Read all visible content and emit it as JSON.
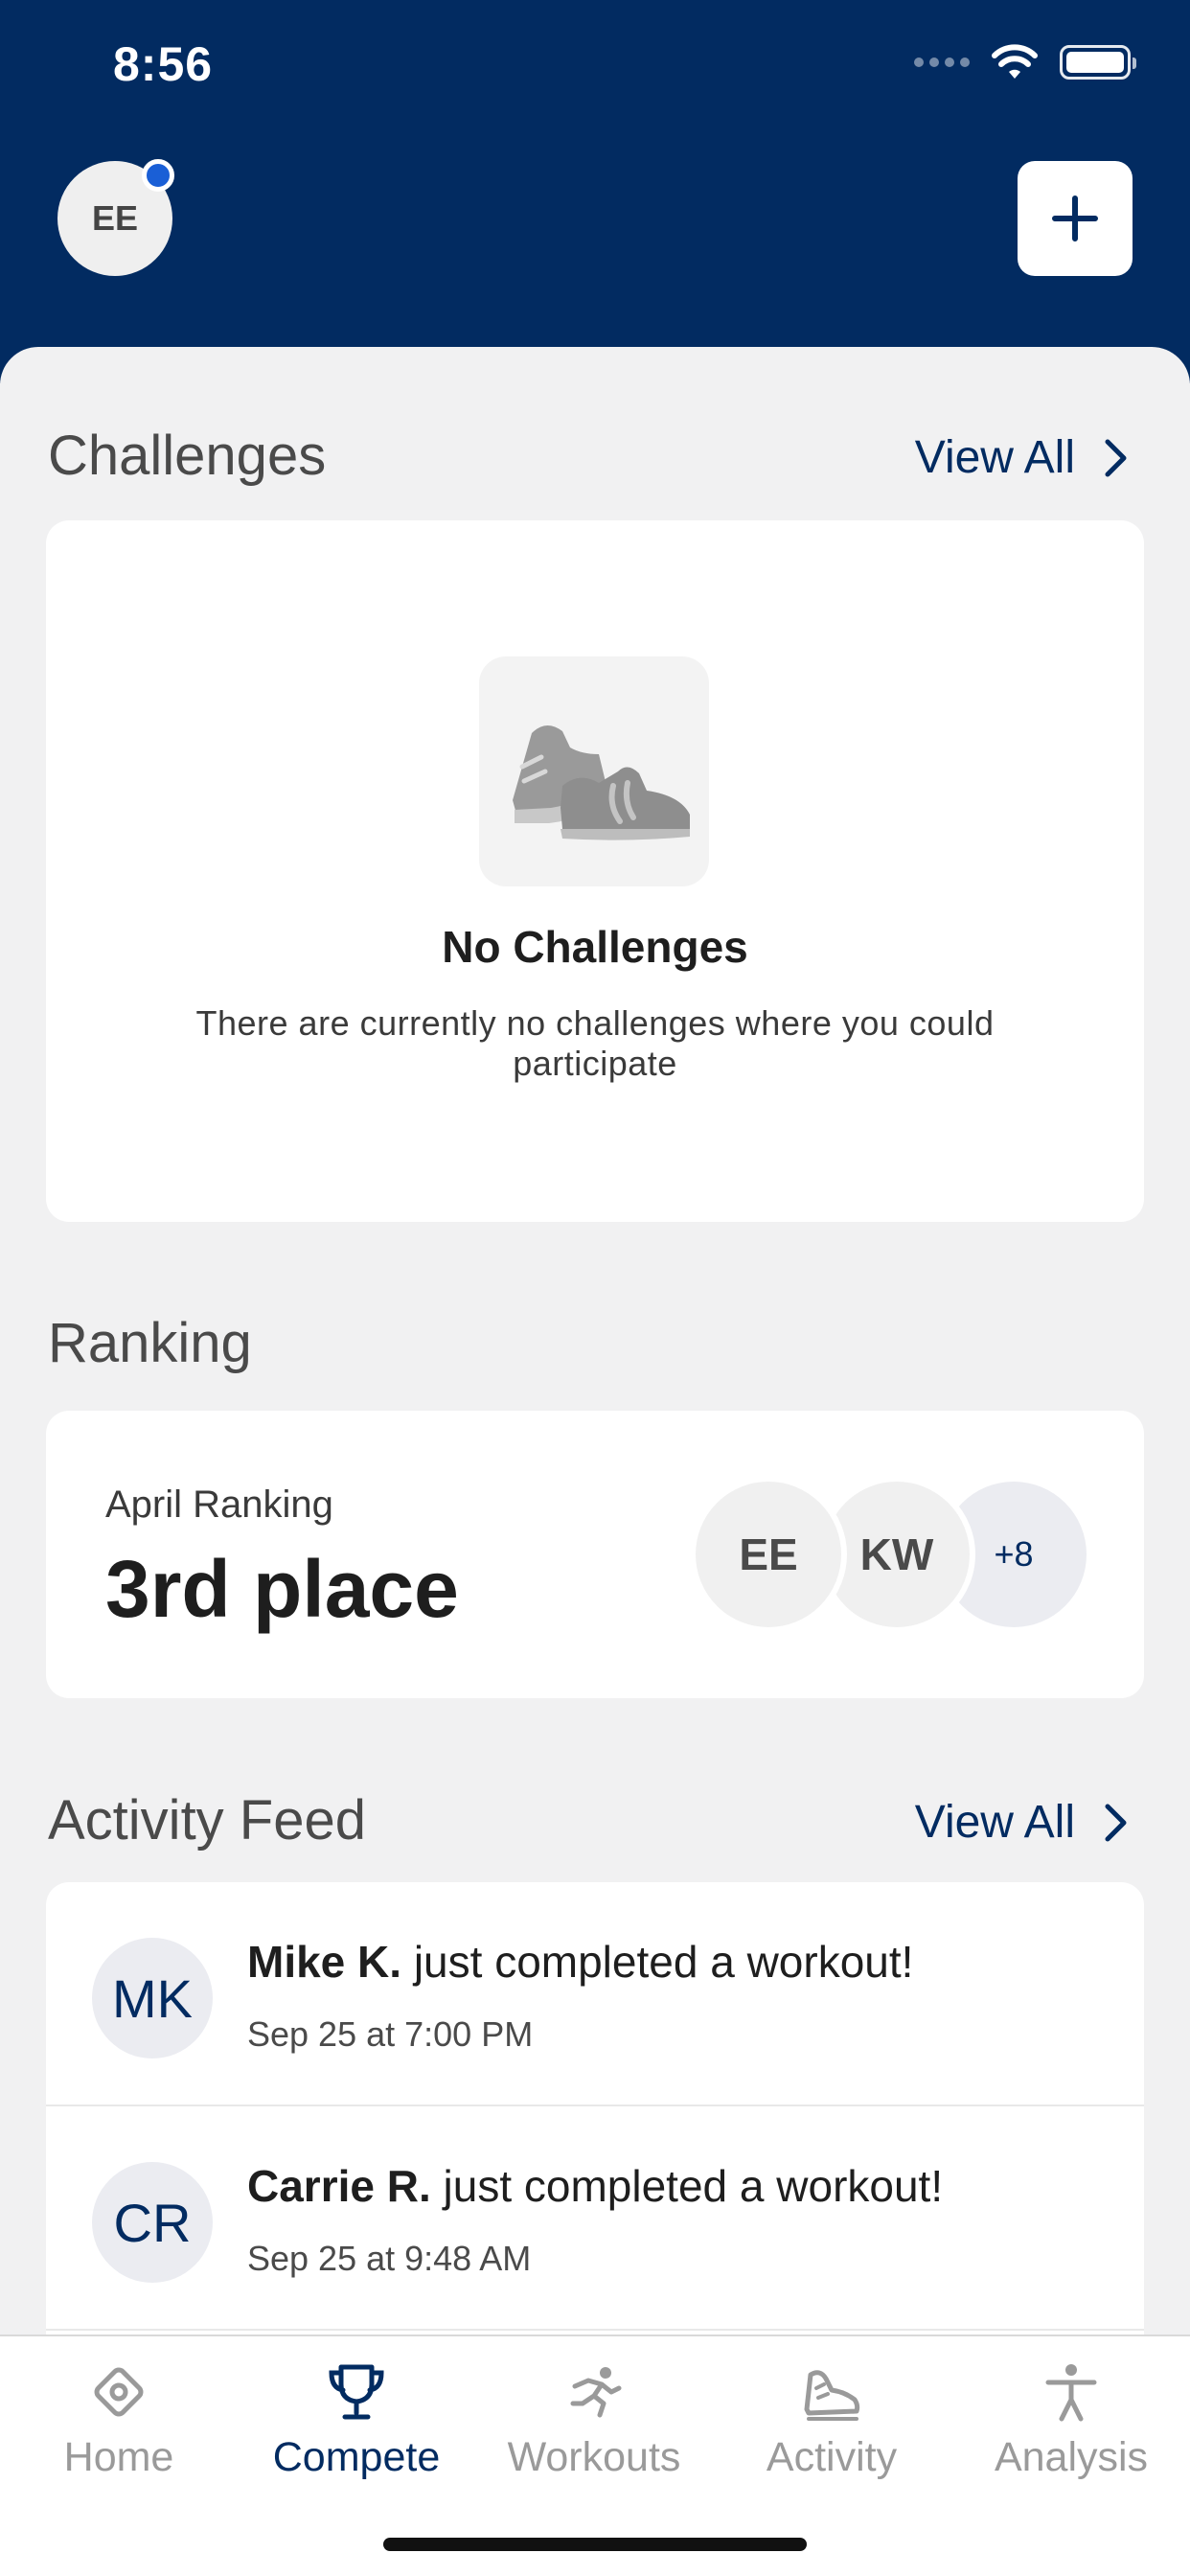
{
  "status_bar": {
    "time": "8:56"
  },
  "header": {
    "avatar_initials": "EE"
  },
  "challenges": {
    "title": "Challenges",
    "view_all": "View All",
    "empty_title": "No Challenges",
    "empty_description": "There are currently no challenges where you could participate"
  },
  "ranking": {
    "title": "Ranking",
    "label": "April Ranking",
    "value": "3rd place",
    "avatars": [
      "EE",
      "KW"
    ],
    "more": "+8"
  },
  "activity_feed": {
    "title": "Activity Feed",
    "view_all": "View All",
    "items": [
      {
        "initials": "MK",
        "name": "Mike K.",
        "action": " just completed a workout!",
        "time": "Sep 25 at 7:00 PM"
      },
      {
        "initials": "CR",
        "name": "Carrie R.",
        "action": " just completed a workout!",
        "time": "Sep 25 at 9:48 AM"
      }
    ]
  },
  "tabs": [
    {
      "label": "Home",
      "icon": "home-icon",
      "active": false
    },
    {
      "label": "Compete",
      "icon": "trophy-icon",
      "active": true
    },
    {
      "label": "Workouts",
      "icon": "runner-icon",
      "active": false
    },
    {
      "label": "Activity",
      "icon": "shoe-icon",
      "active": false
    },
    {
      "label": "Analysis",
      "icon": "person-icon",
      "active": false
    }
  ],
  "colors": {
    "brand": "#022b61",
    "active_tab": "#022b61",
    "inactive_tab": "#9a9a9a",
    "notification_dot": "#1a5fd6"
  }
}
